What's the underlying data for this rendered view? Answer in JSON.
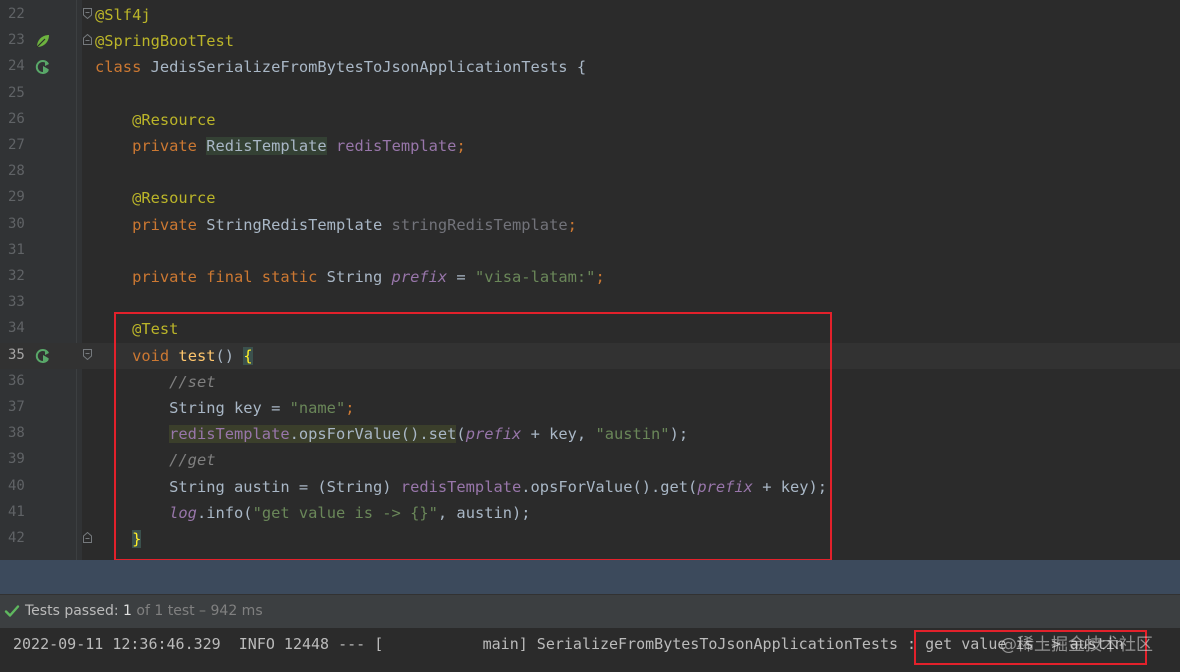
{
  "editor": {
    "current_line": 35,
    "lines": [
      {
        "num": "22",
        "tokens": [
          {
            "t": "@Slf4j",
            "c": "ann"
          }
        ],
        "fold": "top"
      },
      {
        "num": "23",
        "tokens": [
          {
            "t": "@SpringBootTest",
            "c": "ann"
          }
        ],
        "icon": "spring-leaf-icon",
        "fold": "bottom"
      },
      {
        "num": "24",
        "tokens": [
          {
            "t": "class ",
            "c": "kw"
          },
          {
            "t": "JedisSerializeFromBytesToJsonApplicationTests {",
            "c": ""
          }
        ],
        "icon": "run-test-icon"
      },
      {
        "num": "25",
        "tokens": []
      },
      {
        "num": "26",
        "tokens": [
          {
            "t": "    "
          },
          {
            "t": "@Resource",
            "c": "ann"
          }
        ]
      },
      {
        "num": "27",
        "tokens": [
          {
            "t": "    "
          },
          {
            "t": "private ",
            "c": "kw"
          },
          {
            "t": "RedisTemplate",
            "c": "hl"
          },
          {
            "t": " "
          },
          {
            "t": "redisTemplate",
            "c": "fld"
          },
          {
            "t": ";",
            "c": "kw"
          }
        ]
      },
      {
        "num": "28",
        "tokens": []
      },
      {
        "num": "29",
        "tokens": [
          {
            "t": "    "
          },
          {
            "t": "@Resource",
            "c": "ann"
          }
        ]
      },
      {
        "num": "30",
        "tokens": [
          {
            "t": "    "
          },
          {
            "t": "private ",
            "c": "kw"
          },
          {
            "t": "StringRedisTemplate "
          },
          {
            "t": "stringRedisTemplate",
            "c": "unused"
          },
          {
            "t": ";",
            "c": "kw"
          }
        ]
      },
      {
        "num": "31",
        "tokens": []
      },
      {
        "num": "32",
        "tokens": [
          {
            "t": "    "
          },
          {
            "t": "private final static ",
            "c": "kw"
          },
          {
            "t": "String "
          },
          {
            "t": "prefix",
            "c": "fldi"
          },
          {
            "t": " = "
          },
          {
            "t": "\"visa-latam:\"",
            "c": "str"
          },
          {
            "t": ";",
            "c": "kw"
          }
        ]
      },
      {
        "num": "33",
        "tokens": []
      },
      {
        "num": "34",
        "tokens": [
          {
            "t": "    "
          },
          {
            "t": "@Test",
            "c": "ann"
          }
        ]
      },
      {
        "num": "35",
        "tokens": [
          {
            "t": "    "
          },
          {
            "t": "void ",
            "c": "kw"
          },
          {
            "t": "test",
            "c": "meth"
          },
          {
            "t": "() "
          },
          {
            "t": "{",
            "c": "brace"
          }
        ],
        "icon": "run-test-icon",
        "fold": "top"
      },
      {
        "num": "36",
        "tokens": [
          {
            "t": "        "
          },
          {
            "t": "//set",
            "c": "cmt"
          }
        ]
      },
      {
        "num": "37",
        "tokens": [
          {
            "t": "        "
          },
          {
            "t": "String key = "
          },
          {
            "t": "\"name\"",
            "c": "str"
          },
          {
            "t": ";",
            "c": "kw"
          }
        ]
      },
      {
        "num": "38",
        "tokens": [
          {
            "t": "        "
          },
          {
            "t": "redisTemplate",
            "c": "fld hl2"
          },
          {
            "t": ".opsForValue().set",
            "c": "hl2"
          },
          {
            "t": "("
          },
          {
            "t": "prefix",
            "c": "fldi"
          },
          {
            "t": " + key, "
          },
          {
            "t": "\"austin\"",
            "c": "str"
          },
          {
            "t": ");"
          }
        ]
      },
      {
        "num": "39",
        "tokens": [
          {
            "t": "        "
          },
          {
            "t": "//get",
            "c": "cmt"
          }
        ]
      },
      {
        "num": "40",
        "tokens": [
          {
            "t": "        "
          },
          {
            "t": "String austin = (String) "
          },
          {
            "t": "redisTemplate",
            "c": "fld"
          },
          {
            "t": ".opsForValue().get("
          },
          {
            "t": "prefix",
            "c": "fldi"
          },
          {
            "t": " + key);"
          }
        ]
      },
      {
        "num": "41",
        "tokens": [
          {
            "t": "        "
          },
          {
            "t": "log",
            "c": "fldi"
          },
          {
            "t": ".info("
          },
          {
            "t": "\"get value is -> {}\"",
            "c": "str"
          },
          {
            "t": ", austin);"
          }
        ]
      },
      {
        "num": "42",
        "tokens": [
          {
            "t": "    "
          },
          {
            "t": "}",
            "c": "brace"
          }
        ],
        "fold": "bottom"
      }
    ]
  },
  "test_status": {
    "label": "Tests passed: ",
    "count": "1",
    "rest": " of 1 test – 942 ms",
    "icon": "check-icon"
  },
  "console": {
    "line": "2022-09-11 12:36:46.329  INFO 12448 --- [           main] SerializeFromBytesToJsonApplicationTests : get value is -> austin"
  },
  "watermark": "@稀土掘金技术社区",
  "colors": {
    "annotation": "#bbb529",
    "keyword": "#cc7832",
    "field": "#9876aa",
    "string": "#6a8759",
    "comment": "#808080",
    "method": "#ffc66d",
    "highlight_box": "#e3212b"
  }
}
